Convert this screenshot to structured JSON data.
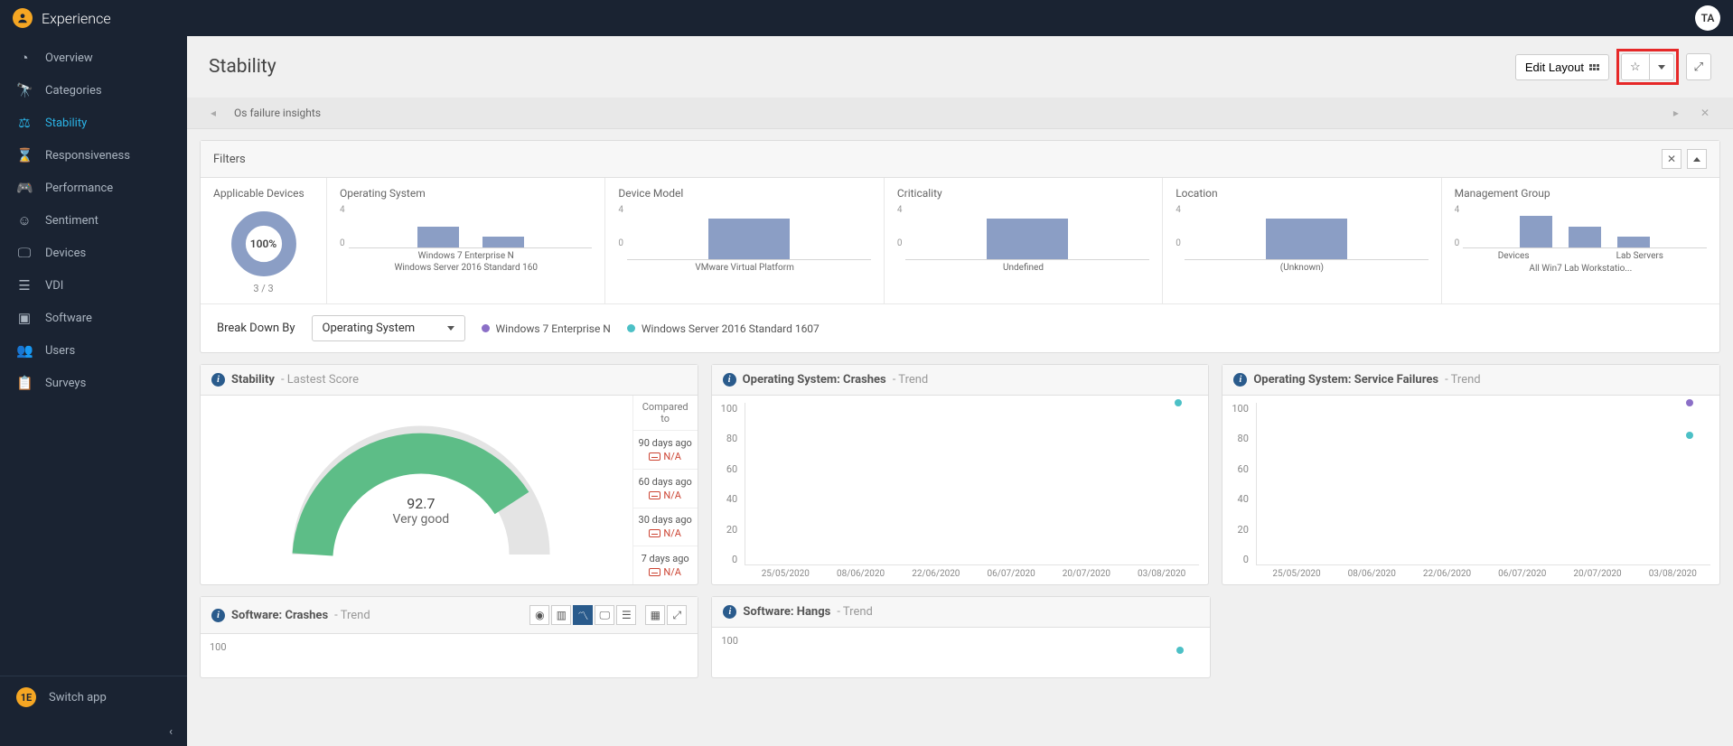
{
  "brand": "Experience",
  "user_initials": "TA",
  "sidebar": {
    "items": [
      {
        "label": "Overview"
      },
      {
        "label": "Categories"
      },
      {
        "label": "Stability"
      },
      {
        "label": "Responsiveness"
      },
      {
        "label": "Performance"
      },
      {
        "label": "Sentiment"
      },
      {
        "label": "Devices"
      },
      {
        "label": "VDI"
      },
      {
        "label": "Software"
      },
      {
        "label": "Users"
      },
      {
        "label": "Surveys"
      }
    ],
    "active_index": 2,
    "switch_app": "Switch app"
  },
  "page": {
    "title": "Stability",
    "edit_layout": "Edit Layout",
    "breadcrumb": "Os failure insights"
  },
  "filters": {
    "title": "Filters",
    "applicable": {
      "title": "Applicable Devices",
      "pct": "100%",
      "ratio": "3 / 3"
    },
    "cells": [
      {
        "title": "Operating System",
        "ymax": "4",
        "ymin": "0",
        "labels": [
          "Windows 7 Enterprise N",
          "Windows Server 2016 Standard 160"
        ]
      },
      {
        "title": "Device Model",
        "ymax": "4",
        "ymin": "0",
        "labels": [
          "VMware Virtual Platform"
        ]
      },
      {
        "title": "Criticality",
        "ymax": "4",
        "ymin": "0",
        "labels": [
          "Undefined"
        ]
      },
      {
        "title": "Location",
        "ymax": "4",
        "ymin": "0",
        "labels": [
          "(Unknown)"
        ]
      },
      {
        "title": "Management Group",
        "ymax": "4",
        "ymin": "0",
        "labels": [
          "Devices",
          "All Win7 Lab Workstatio...",
          "Lab Servers"
        ]
      }
    ]
  },
  "breakdown": {
    "label": "Break Down By",
    "selected": "Operating System",
    "legend": [
      {
        "color": "#8b6fc7",
        "label": "Windows 7 Enterprise N"
      },
      {
        "color": "#4cc0c6",
        "label": "Windows Server 2016 Standard 1607"
      }
    ]
  },
  "widgets": {
    "stability": {
      "title": "Stability",
      "subtitle": "- Lastest Score",
      "value": "92.7",
      "value_label": "Very good",
      "compared_to": "Compared to",
      "compare": [
        {
          "period": "90 days ago",
          "value": "N/A"
        },
        {
          "period": "60 days ago",
          "value": "N/A"
        },
        {
          "period": "30 days ago",
          "value": "N/A"
        },
        {
          "period": "7 days ago",
          "value": "N/A"
        }
      ]
    },
    "os_crashes": {
      "title": "Operating System: Crashes",
      "subtitle": "- Trend"
    },
    "os_service_failures": {
      "title": "Operating System: Service Failures",
      "subtitle": "- Trend"
    },
    "sw_crashes": {
      "title": "Software: Crashes",
      "subtitle": "- Trend"
    },
    "sw_hangs": {
      "title": "Software: Hangs",
      "subtitle": "- Trend"
    }
  },
  "chart_data": {
    "filter_bars": [
      {
        "name": "Operating System",
        "ymax": 4,
        "categories": [
          "Windows 7 Enterprise N",
          "Windows Server 2016 Standard 1607"
        ],
        "values": [
          2,
          1
        ]
      },
      {
        "name": "Device Model",
        "ymax": 4,
        "categories": [
          "VMware Virtual Platform"
        ],
        "values": [
          3
        ]
      },
      {
        "name": "Criticality",
        "ymax": 4,
        "categories": [
          "Undefined"
        ],
        "values": [
          3
        ]
      },
      {
        "name": "Location",
        "ymax": 4,
        "categories": [
          "(Unknown)"
        ],
        "values": [
          3
        ]
      },
      {
        "name": "Management Group",
        "ymax": 4,
        "categories": [
          "Devices",
          "All Win7 Lab Workstations",
          "Lab Servers"
        ],
        "values": [
          3,
          2,
          1
        ]
      }
    ],
    "gauge": {
      "value": 92.7,
      "min": 0,
      "max": 100
    },
    "trends": {
      "y_ticks": [
        100,
        80,
        60,
        40,
        20,
        0
      ],
      "x_dates": [
        "25/05/2020",
        "08/06/2020",
        "22/06/2020",
        "06/07/2020",
        "20/07/2020",
        "03/08/2020"
      ],
      "os_crashes": {
        "type": "scatter",
        "series": [
          {
            "name": "Windows Server 2016 Standard 1607",
            "color": "#4cc0c6",
            "points": [
              {
                "x": "03/08/2020",
                "y": 100
              }
            ]
          }
        ]
      },
      "os_service_failures": {
        "type": "scatter",
        "series": [
          {
            "name": "Windows 7 Enterprise N",
            "color": "#8b6fc7",
            "points": [
              {
                "x": "03/08/2020",
                "y": 100
              }
            ]
          },
          {
            "name": "Windows Server 2016 Standard 1607",
            "color": "#4cc0c6",
            "points": [
              {
                "x": "03/08/2020",
                "y": 80
              }
            ]
          }
        ]
      },
      "sw_crashes": {
        "type": "scatter",
        "y_ticks": [
          100
        ],
        "series": []
      },
      "sw_hangs": {
        "type": "scatter",
        "y_ticks": [
          100
        ],
        "series": [
          {
            "name": "Windows Server 2016 Standard 1607",
            "color": "#4cc0c6",
            "points": [
              {
                "x": "03/08/2020",
                "y": 100
              }
            ]
          }
        ]
      }
    }
  }
}
